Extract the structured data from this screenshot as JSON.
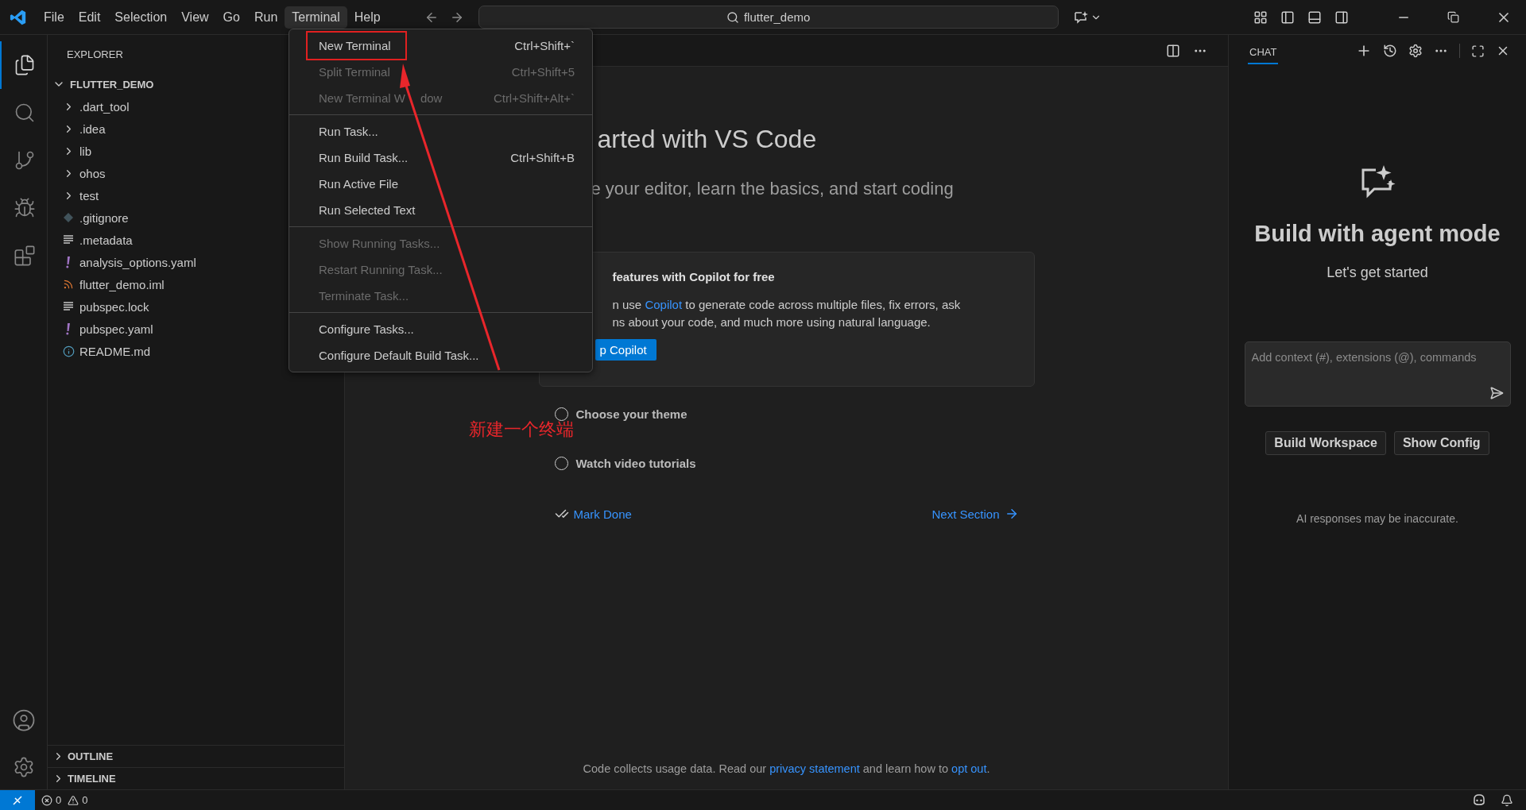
{
  "menu_bar": {
    "items": [
      {
        "label": "File",
        "selected": false
      },
      {
        "label": "Edit",
        "selected": false
      },
      {
        "label": "Selection",
        "selected": false
      },
      {
        "label": "View",
        "selected": false
      },
      {
        "label": "Go",
        "selected": false
      },
      {
        "label": "Run",
        "selected": false
      },
      {
        "label": "Terminal",
        "selected": true
      },
      {
        "label": "Help",
        "selected": false
      }
    ]
  },
  "command_center": {
    "value": "flutter_demo"
  },
  "activity_bar": {
    "items": [
      {
        "kind": "explorer",
        "selected": true
      },
      {
        "kind": "search",
        "selected": false
      },
      {
        "kind": "source_control",
        "selected": false
      },
      {
        "kind": "debug",
        "selected": false
      },
      {
        "kind": "extensions",
        "selected": false
      }
    ]
  },
  "explorer": {
    "title": "EXPLORER",
    "root": {
      "label": "FLUTTER_DEMO",
      "expanded": true,
      "children": [
        {
          "label": ".dart_tool",
          "kind": "folder",
          "expanded": false
        },
        {
          "label": ".idea",
          "kind": "folder",
          "expanded": false
        },
        {
          "label": "lib",
          "kind": "folder",
          "expanded": false
        },
        {
          "label": "ohos",
          "kind": "folder",
          "expanded": false
        },
        {
          "label": "test",
          "kind": "folder",
          "expanded": false
        },
        {
          "label": ".gitignore",
          "kind": "git"
        },
        {
          "label": ".metadata",
          "kind": "lines"
        },
        {
          "label": "analysis_options.yaml",
          "kind": "yaml"
        },
        {
          "label": "flutter_demo.iml",
          "kind": "rss"
        },
        {
          "label": "pubspec.lock",
          "kind": "lines"
        },
        {
          "label": "pubspec.yaml",
          "kind": "yaml"
        },
        {
          "label": "README.md",
          "kind": "info"
        }
      ]
    },
    "sections": [
      {
        "label": "OUTLINE",
        "expanded": false
      },
      {
        "label": "TIMELINE",
        "expanded": false
      }
    ]
  },
  "terminal_menu": {
    "groups": [
      [
        {
          "label": "New Terminal",
          "shortcut": "Ctrl+Shift+`",
          "disabled": false,
          "boxed": true
        },
        {
          "label": "Split Terminal",
          "shortcut": "Ctrl+Shift+5",
          "disabled": true,
          "boxed": false
        },
        {
          "label": "New Terminal W",
          "label_rest": "dow",
          "shortcut": "Ctrl+Shift+Alt+`",
          "disabled": true,
          "boxed": false
        }
      ],
      [
        {
          "label": "Run Task...",
          "disabled": false,
          "boxed": false
        },
        {
          "label": "Run Build Task...",
          "shortcut": "Ctrl+Shift+B",
          "disabled": false,
          "boxed": false
        },
        {
          "label": "Run Active File",
          "disabled": false,
          "boxed": false
        },
        {
          "label": "Run Selected Text",
          "disabled": false,
          "boxed": false
        }
      ],
      [
        {
          "label": "Show Running Tasks...",
          "disabled": true,
          "boxed": false
        },
        {
          "label": "Restart Running Task...",
          "disabled": true,
          "boxed": false
        },
        {
          "label": "Terminate Task...",
          "disabled": true,
          "boxed": false
        }
      ],
      [
        {
          "label": "Configure Tasks...",
          "disabled": false,
          "boxed": false
        },
        {
          "label": "Configure Default Build Task...",
          "disabled": false,
          "boxed": false
        }
      ]
    ]
  },
  "annotation": {
    "text": "新建一个终端"
  },
  "welcome": {
    "title": "arted with VS Code",
    "subtitle": "e your editor, learn the basics, and start coding",
    "card": {
      "title": "features with Copilot for free",
      "before": "n use ",
      "link": "Copilot",
      "after": " to generate code across multiple files, fix errors, ask",
      "continuation": "ns about your code, and much more using natural language.",
      "button": "p Copilot"
    },
    "steps": [
      {
        "label": "Choose your theme",
        "done": false
      },
      {
        "label": "Watch video tutorials",
        "done": false
      }
    ],
    "mark_done": "Mark Done",
    "next_section": "Next Section",
    "footer": {
      "before": "Code collects usage data. Read our ",
      "link1": "privacy statement",
      "middle": " and learn how to ",
      "link2": "opt out",
      "after": "."
    }
  },
  "chat": {
    "tab": {
      "label": "CHAT",
      "selected": true
    },
    "heading": "Build with agent mode",
    "subheading": "Let's get started",
    "input": {
      "placeholder": "Add context (#), extensions (@), commands"
    },
    "buttons": [
      "Build Workspace",
      "Show Config"
    ],
    "note": "AI responses may be inaccurate."
  },
  "status_bar": {
    "errors": "0",
    "warnings": "0"
  }
}
